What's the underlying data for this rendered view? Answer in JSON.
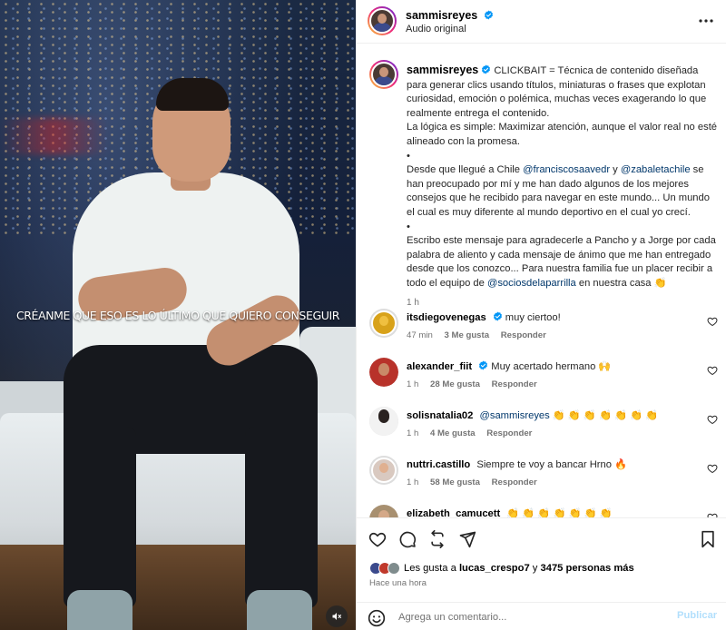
{
  "media": {
    "subtitle": "CRÉANME QUE ESO ES LO ÚLTIMO QUE QUIERO CONSEGUIR"
  },
  "header": {
    "username": "sammisreyes",
    "audio": "Audio original"
  },
  "caption": {
    "username": "sammisreyes",
    "p1": "CLICKBAIT = Técnica de contenido diseñada para generar clics usando títulos, miniaturas o frases que explotan curiosidad, emoción o polémica, muchas veces exagerando lo que realmente entrega el contenido.",
    "p2": "La lógica es simple: Maximizar atención, aunque el valor real no esté alineado con la promesa.",
    "bullet": "•",
    "p3a": "Desde que llegué a Chile ",
    "mention1": "@franciscosaavedr",
    "p3b": " y ",
    "mention2": "@zabaletachile",
    "p3c": " se han preocupado por mí y me han dado algunos de los mejores consejos que he recibido para navegar en este mundo... Un mundo el cual es muy diferente al mundo deportivo en el cual yo crecí.",
    "p4a": "Escribo este mensaje para agradecerle a Pancho y a Jorge por cada palabra de aliento y cada mensaje de ánimo que me han entregado desde que los conozco... Para nuestra familia fue un placer recibir a todo el equipo de ",
    "mention3": "@sociosdelaparrilla",
    "p4b": " en nuestra casa 👏",
    "time": "1 h"
  },
  "comments": [
    {
      "username": "itsdiegovenegas",
      "verified": true,
      "text": "muy ciertoo!",
      "time": "47 min",
      "likes": "3 Me gusta",
      "reply": "Responder"
    },
    {
      "username": "alexander_fiit",
      "verified": true,
      "text": "Muy acertado hermano 🙌",
      "time": "1 h",
      "likes": "28 Me gusta",
      "reply": "Responder"
    },
    {
      "username": "solisnatalia02",
      "verified": false,
      "mention": "@sammisreyes",
      "text": " 👏 👏 👏 👏 👏 👏 👏",
      "time": "1 h",
      "likes": "4 Me gusta",
      "reply": "Responder"
    },
    {
      "username": "nuttri.castillo",
      "verified": false,
      "text": "Siempre te voy a bancar Hrno 🔥",
      "time": "1 h",
      "likes": "58 Me gusta",
      "reply": "Responder"
    },
    {
      "username": "elizabeth_camucett",
      "verified": false,
      "text": "👏 👏 👏 👏 👏 👏 👏",
      "time": "",
      "likes": "",
      "reply": ""
    }
  ],
  "likes": {
    "prefix": "Les gusta a ",
    "user": "lucas_crespo7",
    "mid": " y ",
    "others": "3475 personas más"
  },
  "ago": "Hace una hora",
  "comment_box": {
    "placeholder": "Agrega un comentario...",
    "post_label": "Publicar"
  },
  "colors": {
    "accent": "#0095f6",
    "mention": "#00376b",
    "post_disabled": "#b2dffc",
    "secondary_text": "#737373"
  },
  "icons": [
    "verified-icon",
    "more-icon",
    "heart-icon",
    "comment-icon",
    "share-icon",
    "send-icon",
    "bookmark-icon",
    "emoji-icon",
    "mute-icon"
  ]
}
